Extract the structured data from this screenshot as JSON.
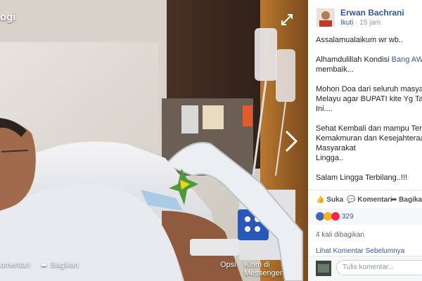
{
  "viewer": {
    "title": "ogi",
    "comment_label": "omentari",
    "share_label": "Bagikan",
    "options_label": "Opsi",
    "messenger_label": "Kirim di Messenger"
  },
  "post": {
    "author": "Erwan Bachrani",
    "follow": "Ikuti",
    "time": "15 jam",
    "p1": "Assalamualaikum wr wb..",
    "p2_before": "Alhamdulillah Kondisi ",
    "p2_mention": "Bang AWe",
    "p2_after": " sudah\nmembaik...",
    "p3": "Mohon Doa dari seluruh masyarakat\nMelayu agar BUPATI kite Yg Tak pernah\nIni....",
    "p4": "Sehat Kembali dan mampu Terus\nKemakmuran dan Kesejahteraan Masyarakat\nLingga..",
    "p5": "Salam Lingga Terbilang..!!!"
  },
  "actions": {
    "like": "Suka",
    "comment": "Komentari",
    "share": "Bagikan"
  },
  "reactions": {
    "count": "329"
  },
  "shares": "4 kali dibagikan",
  "more_comments": "Lihat Komentar Sebelumnya",
  "comment_box": {
    "placeholder": "Tulis komentar..."
  },
  "colors": {
    "link": "#365899",
    "like": "#4267b2",
    "love": "#f0284a",
    "haha": "#f7b125"
  }
}
